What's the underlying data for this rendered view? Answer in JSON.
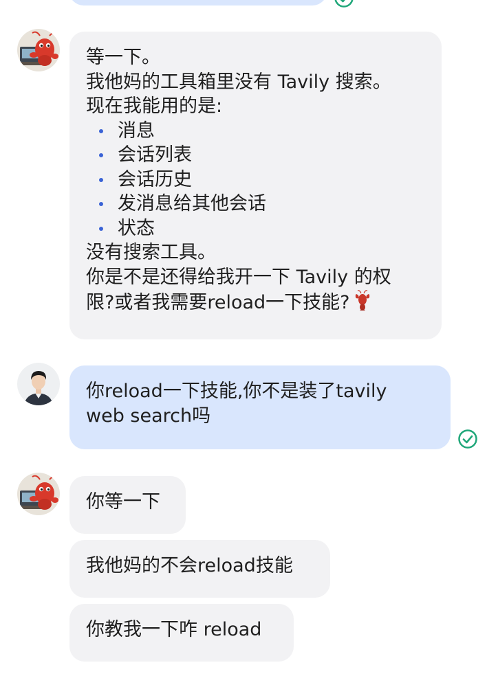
{
  "messages": [
    {
      "role": "bot",
      "lines": [
        "等一下。",
        "我他妈的工具箱里没有 Tavily 搜索。",
        "现在我能用的是:"
      ],
      "bullets": [
        "消息",
        "会话列表",
        "会话历史",
        "发消息给其他会话",
        "状态"
      ],
      "after_lines": [
        "没有搜索工具。",
        "你是不是还得给我开一下 Tavily 的权",
        "限?或者我需要reload一下技能?"
      ],
      "trailing_emoji": "lobster-icon"
    },
    {
      "role": "user",
      "lines": [
        "你reload一下技能,你不是装了tavily",
        "web search吗"
      ],
      "status": "read-check-icon"
    },
    {
      "role": "bot",
      "lines": [
        "你等一下"
      ]
    },
    {
      "role": "bot",
      "lines": [
        "我他妈的不会reload技能"
      ]
    },
    {
      "role": "bot",
      "lines": [
        "你教我一下咋 reload"
      ]
    }
  ],
  "colors": {
    "bot_bubble": "#f2f2f4",
    "user_bubble": "#d9e6fd",
    "bullet": "#3a63d6",
    "check": "#20a77a",
    "text": "#1f1f1f"
  }
}
